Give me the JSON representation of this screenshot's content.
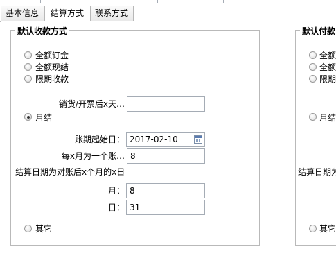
{
  "tabs": [
    {
      "label": "基本信息",
      "active": false
    },
    {
      "label": "结算方式",
      "active": true
    },
    {
      "label": "联系方式",
      "active": false
    }
  ],
  "receive": {
    "legend": "默认收款方式",
    "options": [
      "全额订金",
      "全额现结",
      "限期收款"
    ],
    "days_label": "销货/开票后x天…",
    "days_value": "",
    "monthly_label": "月结",
    "start_label": "账期起始日：",
    "start_value": "2017-02-10",
    "months_label": "每x月为一个账…",
    "months_value": "8",
    "rule_text": "结算日期为对账后x个月的x日",
    "month_label": "月：",
    "month_value": "8",
    "day_label": "日：",
    "day_value": "31",
    "other_label": "其它"
  },
  "pay": {
    "legend": "默认付款",
    "options": [
      "全额",
      "全额",
      "限期"
    ],
    "monthly_label": "月结",
    "rule_text": "结算日期为",
    "other_label": "其它"
  }
}
